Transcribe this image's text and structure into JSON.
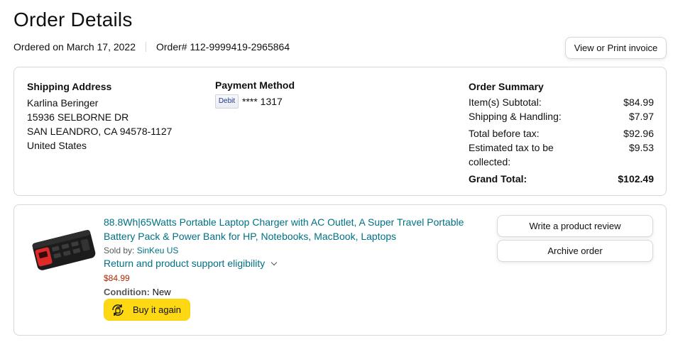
{
  "header": {
    "title": "Order Details",
    "ordered_on": "Ordered on March 17, 2022",
    "order_number": "Order# 112-9999419-2965864",
    "invoice_button": "View or Print invoice"
  },
  "shipping": {
    "title": "Shipping Address",
    "name": "Karlina Beringer",
    "street": "15936 SELBORNE DR",
    "city": "SAN LEANDRO, CA 94578-1127",
    "country": "United States"
  },
  "payment": {
    "title": "Payment Method",
    "card_badge": "Debit",
    "card_number": "**** 1317"
  },
  "summary": {
    "title": "Order Summary",
    "rows": [
      {
        "label": "Item(s) Subtotal:",
        "value": "$84.99"
      },
      {
        "label": "Shipping & Handling:",
        "value": "$7.97"
      },
      {
        "label": "Total before tax:",
        "value": "$92.96"
      },
      {
        "label": "Estimated tax to be collected:",
        "value": "$9.53"
      }
    ],
    "grand_label": "Grand Total:",
    "grand_value": "$102.49"
  },
  "item": {
    "image_icon": "power-bank-image",
    "title": "88.8Wh|65Watts Portable Laptop Charger with AC Outlet, A Super Travel Portable Battery Pack & Power Bank for HP, Notebooks, MacBook, Laptops",
    "sold_by_label": "Sold by:",
    "seller": "SinKeu US",
    "support_link": "Return and product support eligibility",
    "price": "$84.99",
    "condition_label": "Condition:",
    "condition_value": "New",
    "buy_again": "Buy it again",
    "review_button": "Write a product review",
    "archive_button": "Archive order"
  },
  "colors": {
    "link": "#007185",
    "price": "#b12704",
    "buy_button": "#ffd814",
    "border": "#d5d9d9"
  }
}
